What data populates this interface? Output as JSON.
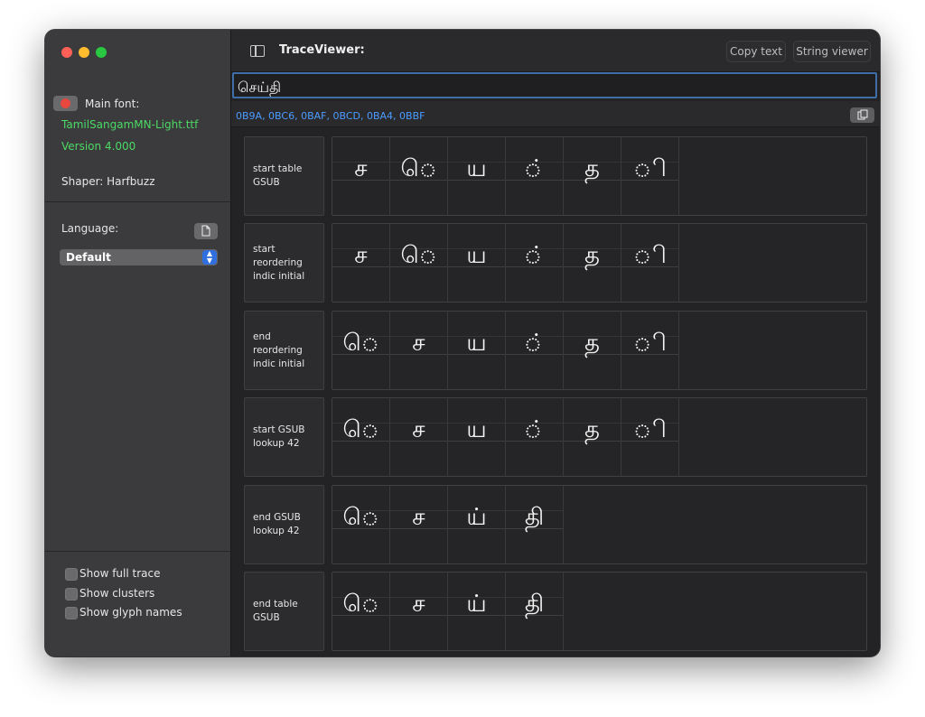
{
  "sidebar": {
    "main_font_label": "Main font:",
    "font_file": "TamilSangamMN-Light.ttf",
    "font_version": "Version 4.000",
    "shaper": "Shaper: Harfbuzz",
    "language_label": "Language:",
    "language_value": "Default",
    "checkboxes": [
      {
        "label": "Show full trace",
        "checked": false
      },
      {
        "label": "Show clusters",
        "checked": false
      },
      {
        "label": "Show glyph names",
        "checked": false
      }
    ]
  },
  "toolbar": {
    "title": "TraceViewer:",
    "copy_text_label": "Copy text",
    "string_viewer_label": "String viewer"
  },
  "input": {
    "text": "செய்தி",
    "codepoints": "0B9A, 0BC6, 0BAF, 0BCD, 0BA4, 0BBF"
  },
  "stages": [
    {
      "label": "start table GSUB",
      "glyphs": [
        "ச",
        "ெ",
        "ய",
        "்",
        "த",
        "ி"
      ]
    },
    {
      "label": "start reordering indic initial",
      "glyphs": [
        "ச",
        "ெ",
        "ய",
        "்",
        "த",
        "ி"
      ]
    },
    {
      "label": "end reordering indic initial",
      "glyphs": [
        "ெ",
        "ச",
        "ய",
        "்",
        "த",
        "ி"
      ]
    },
    {
      "label": "start GSUB lookup 42",
      "glyphs": [
        "ெ",
        "ச",
        "ய",
        "்",
        "த",
        "ி"
      ]
    },
    {
      "label": "end GSUB lookup 42",
      "glyphs": [
        "ெ",
        "ச",
        "ய்",
        "தி"
      ]
    },
    {
      "label": "end table GSUB",
      "glyphs": [
        "ெ",
        "ச",
        "ய்",
        "தி"
      ]
    }
  ],
  "colors": {
    "accent_blue": "#4c9bff",
    "font_green": "#4cd964",
    "close": "#fe5f57",
    "minimize": "#febc2e",
    "maximize": "#28c840"
  }
}
